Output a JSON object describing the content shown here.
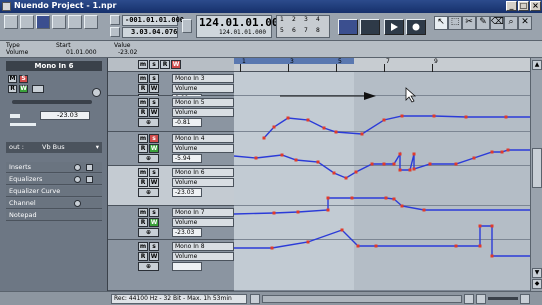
{
  "window": {
    "title": "Nuendo Project - 1.npr"
  },
  "toolbar": {
    "primary_time": "-001.01.01.000",
    "secondary_time": "3.03.04.076",
    "main_position": "124.01.01.000",
    "main_sub": "124.01.01.000",
    "counters": [
      "1",
      "2",
      "3",
      "4",
      "5",
      "6",
      "7",
      "8"
    ]
  },
  "infoline": {
    "type_label": "Type",
    "start_label": "Start",
    "value_label": "Value",
    "type_value": "Volume",
    "start_value": "01.01.000",
    "value_value": "-23.02"
  },
  "inspector": {
    "channel_name": "Mono In 6",
    "volume_value": "-23.03",
    "output_label": "out :",
    "output_value": "Vb Bus",
    "sections": [
      "Inserts",
      "Equalizers",
      "Equalizer Curve",
      "Channel",
      "Notepad"
    ]
  },
  "tracks": [
    {
      "name": "Mono In 3",
      "param": "Volume",
      "value": "0.00",
      "solo": false
    },
    {
      "name": "Mono In 5",
      "param": "Volume",
      "value": "-0.81",
      "solo": false
    },
    {
      "name": "Mono In 4",
      "param": "Volume",
      "value": "-5.94",
      "solo": true
    },
    {
      "name": "Mono In 6",
      "param": "Volume",
      "value": "-23.03",
      "solo": false
    },
    {
      "name": "Mono In 7",
      "param": "Volume",
      "value": "-23.03",
      "solo": false
    },
    {
      "name": "Mono In 8",
      "param": "Volume",
      "value": "",
      "solo": false
    }
  ],
  "ruler": {
    "marks": [
      "1",
      "3",
      "5",
      "7",
      "9"
    ]
  },
  "status": {
    "text": "Rec: 44100 Hz - 32 Bit - Max. 1h 53min"
  },
  "colors": {
    "curve": "#2b3bd8",
    "point": "#e23a2a",
    "solo": "#cf4b4b",
    "write": "#3aa03a"
  }
}
